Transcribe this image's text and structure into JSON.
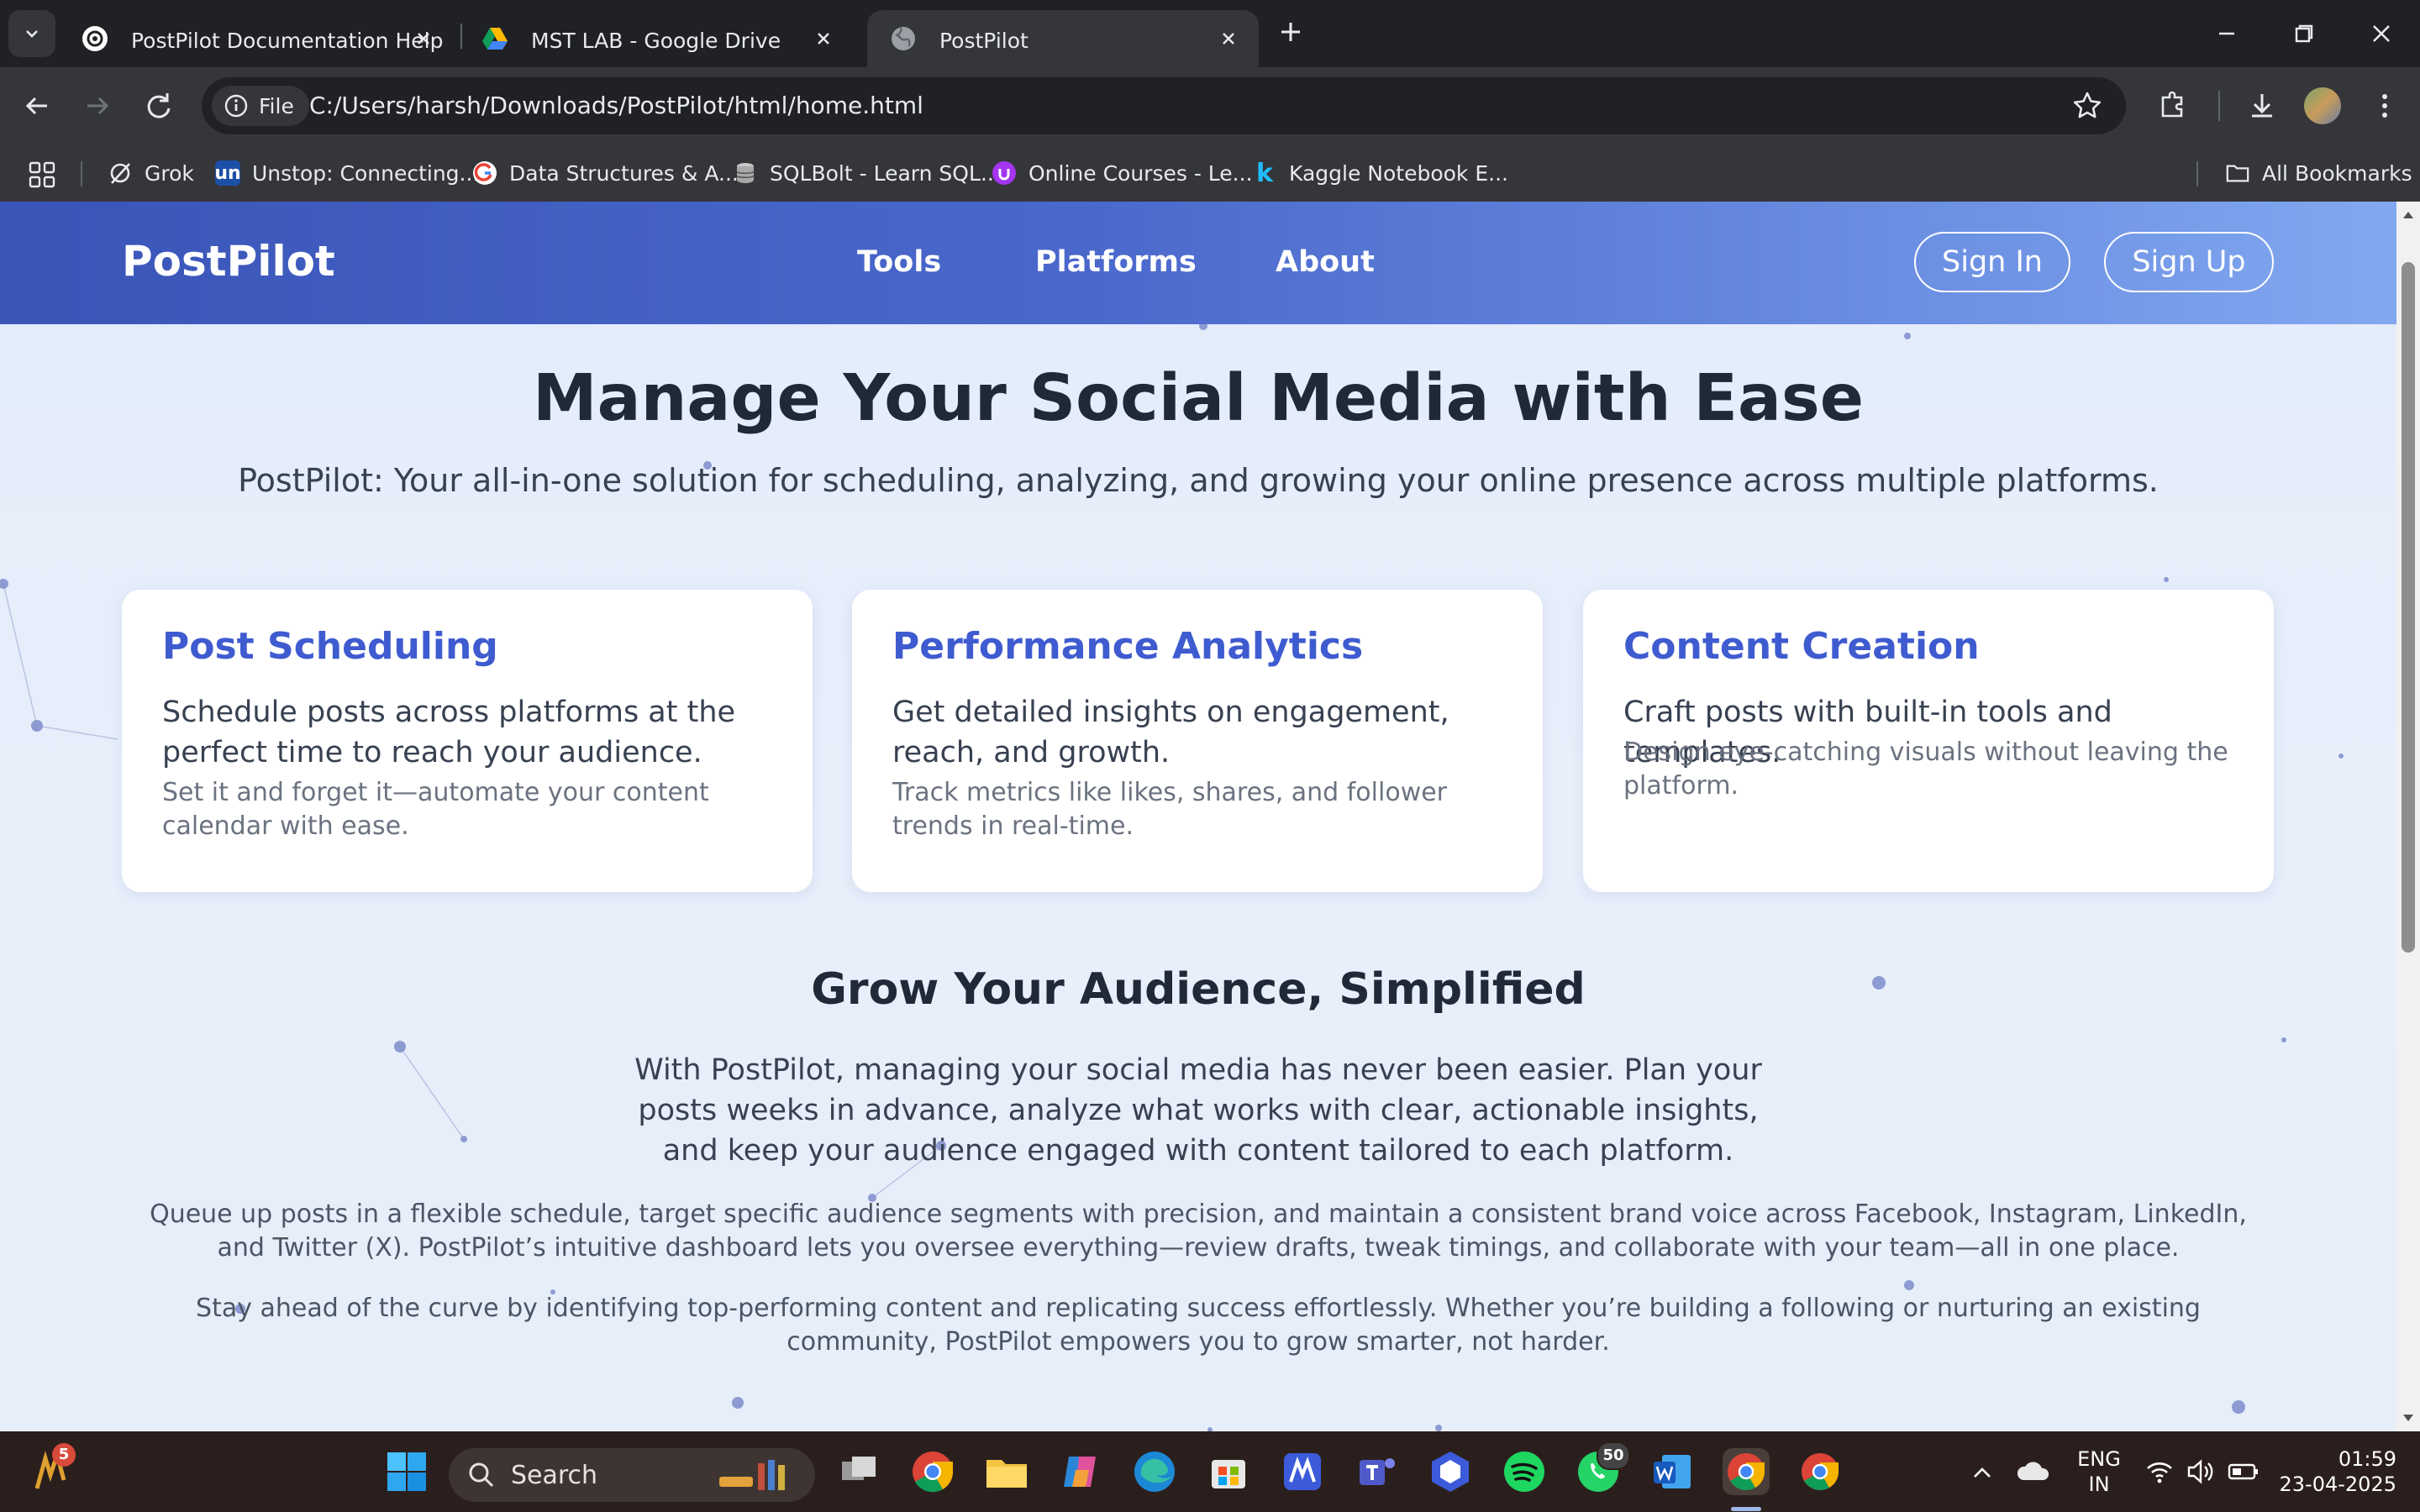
{
  "browser": {
    "tabs": [
      {
        "title": "PostPilot Documentation Help",
        "active": false
      },
      {
        "title": "MST LAB - Google Drive",
        "active": false
      },
      {
        "title": "PostPilot",
        "active": true
      }
    ],
    "address": {
      "chip": "File",
      "url": "C:/Users/harsh/Downloads/PostPilot/html/home.html"
    },
    "bookmarks": [
      {
        "label": "Grok",
        "icon": "grok-icon"
      },
      {
        "label": "Unstop: Connecting...",
        "icon": "unstop-icon"
      },
      {
        "label": "Data Structures & A...",
        "icon": "google-icon"
      },
      {
        "label": "SQLBolt - Learn SQL...",
        "icon": "database-icon"
      },
      {
        "label": "Online Courses - Le...",
        "icon": "udemy-icon"
      },
      {
        "label": "Kaggle Notebook E...",
        "icon": "kaggle-icon"
      }
    ],
    "all_bookmarks": "All Bookmarks"
  },
  "page": {
    "logo": "PostPilot",
    "nav": [
      "Tools",
      "Platforms",
      "About"
    ],
    "sign_in": "Sign In",
    "sign_up": "Sign Up",
    "hero": {
      "title": "Manage Your Social Media with Ease",
      "subtitle": "PostPilot: Your all-in-one solution for scheduling, analyzing, and growing your online presence across multiple platforms."
    },
    "cards": [
      {
        "title": "Post Scheduling",
        "lead": "Schedule posts across platforms at the perfect time to reach your audience.",
        "detail": "Set it and forget it—automate your content calendar with ease."
      },
      {
        "title": "Performance Analytics",
        "lead": "Get detailed insights on engagement, reach, and growth.",
        "detail": "Track metrics like likes, shares, and follower trends in real-time."
      },
      {
        "title": "Content Creation",
        "lead": "Craft posts with built-in tools and templates.",
        "detail": "Design eye-catching visuals without leaving the platform."
      }
    ],
    "section": {
      "title": "Grow Your Audience, Simplified",
      "lead": "With PostPilot, managing your social media has never been easier. Plan your posts weeks in advance, analyze what works with clear, actionable insights, and keep your audience engaged with content tailored to each platform.",
      "p1": "Queue up posts in a flexible schedule, target specific audience segments with precision, and maintain a consistent brand voice across Facebook, Instagram, LinkedIn, and Twitter (X). PostPilot’s intuitive dashboard lets you oversee everything—review drafts, tweak timings, and collaborate with your team—all in one place.",
      "p2": "Stay ahead of the curve by identifying top-performing content and replicating success effortlessly. Whether you’re building a following or nurturing an existing community, PostPilot empowers you to grow smarter, not harder."
    }
  },
  "taskbar": {
    "widget_badge": "5",
    "search": "Search",
    "whatsapp_badge": "50",
    "lang": "ENG",
    "region": "IN",
    "time": "01:59",
    "date": "23-04-2025"
  },
  "colors": {
    "accent": "#3f5bd0",
    "nav_start": "#3a55b8",
    "nav_end": "#82a8f0",
    "page_bg": "#e6eefa"
  }
}
